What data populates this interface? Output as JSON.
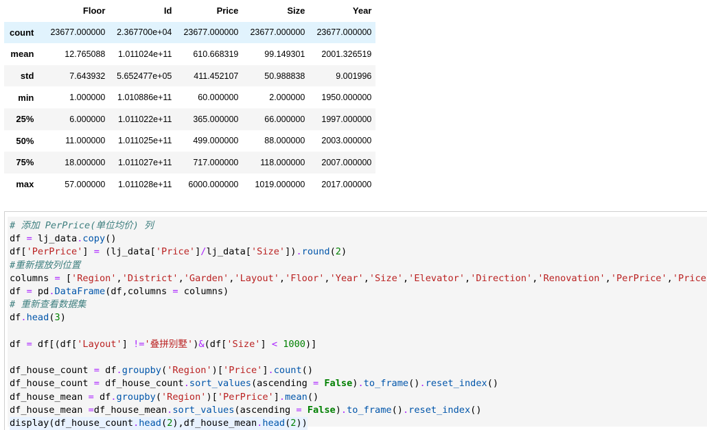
{
  "table": {
    "columns": [
      "Floor",
      "Id",
      "Price",
      "Size",
      "Year"
    ],
    "rows": [
      {
        "label": "count",
        "values": [
          "23677.000000",
          "2.367700e+04",
          "23677.000000",
          "23677.000000",
          "23677.000000"
        ]
      },
      {
        "label": "mean",
        "values": [
          "12.765088",
          "1.011024e+11",
          "610.668319",
          "99.149301",
          "2001.326519"
        ]
      },
      {
        "label": "std",
        "values": [
          "7.643932",
          "5.652477e+05",
          "411.452107",
          "50.988838",
          "9.001996"
        ]
      },
      {
        "label": "min",
        "values": [
          "1.000000",
          "1.010886e+11",
          "60.000000",
          "2.000000",
          "1950.000000"
        ]
      },
      {
        "label": "25%",
        "values": [
          "6.000000",
          "1.011022e+11",
          "365.000000",
          "66.000000",
          "1997.000000"
        ]
      },
      {
        "label": "50%",
        "values": [
          "11.000000",
          "1.011025e+11",
          "499.000000",
          "88.000000",
          "2003.000000"
        ]
      },
      {
        "label": "75%",
        "values": [
          "18.000000",
          "1.011027e+11",
          "717.000000",
          "118.000000",
          "2007.000000"
        ]
      },
      {
        "label": "max",
        "values": [
          "57.000000",
          "1.011028e+11",
          "6000.000000",
          "1019.000000",
          "2017.000000"
        ]
      }
    ]
  },
  "code": {
    "lines": [
      [
        {
          "t": "# 添加 PerPrice(单位均价) 列",
          "c": "cm-comment"
        }
      ],
      [
        {
          "t": "df "
        },
        {
          "t": "=",
          "c": "cm-op"
        },
        {
          "t": " lj_data"
        },
        {
          "t": ".",
          "c": "cm-op"
        },
        {
          "t": "copy",
          "c": "cm-attr"
        },
        {
          "t": "()"
        }
      ],
      [
        {
          "t": "df["
        },
        {
          "t": "'PerPrice'",
          "c": "cm-string"
        },
        {
          "t": "] "
        },
        {
          "t": "=",
          "c": "cm-op"
        },
        {
          "t": " (lj_data["
        },
        {
          "t": "'Price'",
          "c": "cm-string"
        },
        {
          "t": "]"
        },
        {
          "t": "/",
          "c": "cm-op"
        },
        {
          "t": "lj_data["
        },
        {
          "t": "'Size'",
          "c": "cm-string"
        },
        {
          "t": "])"
        },
        {
          "t": ".",
          "c": "cm-op"
        },
        {
          "t": "round",
          "c": "cm-attr"
        },
        {
          "t": "("
        },
        {
          "t": "2",
          "c": "cm-number"
        },
        {
          "t": ")"
        }
      ],
      [
        {
          "t": "#重新摆放列位置",
          "c": "cm-comment"
        }
      ],
      [
        {
          "t": "columns "
        },
        {
          "t": "=",
          "c": "cm-op"
        },
        {
          "t": " ["
        },
        {
          "t": "'Region'",
          "c": "cm-string"
        },
        {
          "t": ","
        },
        {
          "t": "'District'",
          "c": "cm-string"
        },
        {
          "t": ","
        },
        {
          "t": "'Garden'",
          "c": "cm-string"
        },
        {
          "t": ","
        },
        {
          "t": "'Layout'",
          "c": "cm-string"
        },
        {
          "t": ","
        },
        {
          "t": "'Floor'",
          "c": "cm-string"
        },
        {
          "t": ","
        },
        {
          "t": "'Year'",
          "c": "cm-string"
        },
        {
          "t": ","
        },
        {
          "t": "'Size'",
          "c": "cm-string"
        },
        {
          "t": ","
        },
        {
          "t": "'Elevator'",
          "c": "cm-string"
        },
        {
          "t": ","
        },
        {
          "t": "'Direction'",
          "c": "cm-string"
        },
        {
          "t": ","
        },
        {
          "t": "'Renovation'",
          "c": "cm-string"
        },
        {
          "t": ","
        },
        {
          "t": "'PerPrice'",
          "c": "cm-string"
        },
        {
          "t": ","
        },
        {
          "t": "'Price'",
          "c": "cm-string"
        },
        {
          "t": "]"
        }
      ],
      [
        {
          "t": "df "
        },
        {
          "t": "=",
          "c": "cm-op"
        },
        {
          "t": " pd"
        },
        {
          "t": ".",
          "c": "cm-op"
        },
        {
          "t": "DataFrame",
          "c": "cm-attr"
        },
        {
          "t": "(df,columns "
        },
        {
          "t": "=",
          "c": "cm-op"
        },
        {
          "t": " columns)"
        }
      ],
      [
        {
          "t": "# 重新查看数据集",
          "c": "cm-comment"
        }
      ],
      [
        {
          "t": "df"
        },
        {
          "t": ".",
          "c": "cm-op"
        },
        {
          "t": "head",
          "c": "cm-attr"
        },
        {
          "t": "("
        },
        {
          "t": "3",
          "c": "cm-number"
        },
        {
          "t": ")"
        }
      ],
      [
        {
          "t": ""
        }
      ],
      [
        {
          "t": "df "
        },
        {
          "t": "=",
          "c": "cm-op"
        },
        {
          "t": " df[(df["
        },
        {
          "t": "'Layout'",
          "c": "cm-string"
        },
        {
          "t": "] "
        },
        {
          "t": "!=",
          "c": "cm-op"
        },
        {
          "t": "'叠拼别墅'",
          "c": "cm-string"
        },
        {
          "t": ")"
        },
        {
          "t": "&",
          "c": "cm-op"
        },
        {
          "t": "(df["
        },
        {
          "t": "'Size'",
          "c": "cm-string"
        },
        {
          "t": "] "
        },
        {
          "t": "<",
          "c": "cm-op"
        },
        {
          "t": " "
        },
        {
          "t": "1000",
          "c": "cm-number"
        },
        {
          "t": ")]"
        }
      ],
      [
        {
          "t": ""
        }
      ],
      [
        {
          "t": "df_house_count "
        },
        {
          "t": "=",
          "c": "cm-op"
        },
        {
          "t": " df"
        },
        {
          "t": ".",
          "c": "cm-op"
        },
        {
          "t": "groupby",
          "c": "cm-attr"
        },
        {
          "t": "("
        },
        {
          "t": "'Region'",
          "c": "cm-string"
        },
        {
          "t": ")["
        },
        {
          "t": "'Price'",
          "c": "cm-string"
        },
        {
          "t": "]"
        },
        {
          "t": ".",
          "c": "cm-op"
        },
        {
          "t": "count",
          "c": "cm-attr"
        },
        {
          "t": "()"
        }
      ],
      [
        {
          "t": "df_house_count "
        },
        {
          "t": "=",
          "c": "cm-op"
        },
        {
          "t": " df_house_count"
        },
        {
          "t": ".",
          "c": "cm-op"
        },
        {
          "t": "sort_values",
          "c": "cm-attr"
        },
        {
          "t": "(ascending "
        },
        {
          "t": "=",
          "c": "cm-op"
        },
        {
          "t": " "
        },
        {
          "t": "False",
          "c": "cm-kw"
        },
        {
          "t": ")"
        },
        {
          "t": ".",
          "c": "cm-op"
        },
        {
          "t": "to_frame",
          "c": "cm-attr"
        },
        {
          "t": "()"
        },
        {
          "t": ".",
          "c": "cm-op"
        },
        {
          "t": "reset_index",
          "c": "cm-attr"
        },
        {
          "t": "()"
        }
      ],
      [
        {
          "t": "df_house_mean "
        },
        {
          "t": "=",
          "c": "cm-op"
        },
        {
          "t": " df"
        },
        {
          "t": ".",
          "c": "cm-op"
        },
        {
          "t": "groupby",
          "c": "cm-attr"
        },
        {
          "t": "("
        },
        {
          "t": "'Region'",
          "c": "cm-string"
        },
        {
          "t": ")["
        },
        {
          "t": "'PerPrice'",
          "c": "cm-string"
        },
        {
          "t": "]"
        },
        {
          "t": ".",
          "c": "cm-op"
        },
        {
          "t": "mean",
          "c": "cm-attr"
        },
        {
          "t": "()"
        }
      ],
      [
        {
          "t": "df_house_mean "
        },
        {
          "t": "=",
          "c": "cm-op"
        },
        {
          "t": "df_house_mean"
        },
        {
          "t": ".",
          "c": "cm-op"
        },
        {
          "t": "sort_values",
          "c": "cm-attr"
        },
        {
          "t": "(ascending "
        },
        {
          "t": "=",
          "c": "cm-op"
        },
        {
          "t": " "
        },
        {
          "t": "False",
          "c": "cm-kw"
        },
        {
          "t": ")"
        },
        {
          "t": ".",
          "c": "cm-op"
        },
        {
          "t": "to_frame",
          "c": "cm-attr"
        },
        {
          "t": "()"
        },
        {
          "t": ".",
          "c": "cm-op"
        },
        {
          "t": "reset_index",
          "c": "cm-attr"
        },
        {
          "t": "()"
        }
      ],
      [
        {
          "t": "display(df_house_count"
        },
        {
          "t": ".",
          "c": "cm-op"
        },
        {
          "t": "head",
          "c": "cm-attr"
        },
        {
          "t": "("
        },
        {
          "t": "2",
          "c": "cm-number"
        },
        {
          "t": "),df_house_mean"
        },
        {
          "t": ".",
          "c": "cm-op"
        },
        {
          "t": "head",
          "c": "cm-attr"
        },
        {
          "t": "("
        },
        {
          "t": "2",
          "c": "cm-number"
        },
        {
          "t": "))"
        }
      ]
    ]
  }
}
